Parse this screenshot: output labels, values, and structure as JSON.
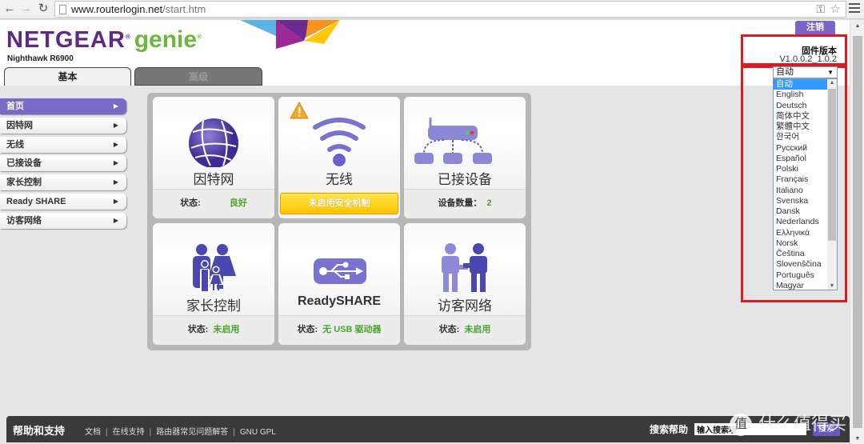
{
  "browser": {
    "url_host": "www.routerlogin.net",
    "url_path": "/start.htm",
    "back_icon": "back-arrow-icon",
    "forward_icon": "forward-arrow-icon",
    "reload_icon": "reload-icon"
  },
  "header": {
    "brand": "NETGEAR",
    "reg_mark": "®",
    "product": "genie",
    "model": "Nighthawk R6900",
    "logout_label": "注销",
    "tabs": [
      {
        "label": "基本",
        "active": true
      },
      {
        "label": "高级",
        "active": false
      }
    ]
  },
  "firmware": {
    "title": "固件版本",
    "version": "V1.0.0.2_1.0.2"
  },
  "language": {
    "selected": "自动",
    "options": [
      "自动",
      "English",
      "Deutsch",
      "简体中文",
      "繁體中文",
      "한국어",
      "Русский",
      "Español",
      "Polski",
      "Français",
      "Italiano",
      "Svenska",
      "Dansk",
      "Nederlands",
      "Ελληνικά",
      "Norsk",
      "Čeština",
      "Slovenščina",
      "Português",
      "Magyar"
    ]
  },
  "sidebar": {
    "items": [
      {
        "label": "首页",
        "active": true
      },
      {
        "label": "因特网",
        "active": false
      },
      {
        "label": "无线",
        "active": false
      },
      {
        "label": "已接设备",
        "active": false
      },
      {
        "label": "家长控制",
        "active": false
      },
      {
        "label": "Ready SHARE",
        "active": false
      },
      {
        "label": "访客网络",
        "active": false
      }
    ]
  },
  "dashboard": {
    "cards": [
      {
        "title": "因特网",
        "icon": "globe-icon",
        "status_label": "状态:",
        "status_value": "良好"
      },
      {
        "title": "无线",
        "icon": "wifi-icon",
        "warning_icon": "warning-icon",
        "warning_text": "未启用安全机制"
      },
      {
        "title": "已接设备",
        "icon": "network-devices-icon",
        "status_label": "设备数量：",
        "status_value": "2"
      },
      {
        "title": "家长控制",
        "icon": "family-icon",
        "status_label": "状态:",
        "status_value": "未启用"
      },
      {
        "title": "ReadySHARE",
        "icon": "usb-icon",
        "status_label": "状态:",
        "status_value": "无 USB 驱动器"
      },
      {
        "title": "访客网络",
        "icon": "guest-handshake-icon",
        "status_label": "状态:",
        "status_value": "未启用"
      }
    ]
  },
  "footer": {
    "title": "帮助和支持",
    "links": [
      "文档",
      "在线支持",
      "路由器常见问题解答",
      "GNU GPL"
    ],
    "search_label": "搜索帮助",
    "search_placeholder": "输入搜索项",
    "search_button": "搜索"
  },
  "watermark": {
    "badge": "值",
    "text": "什么值得买"
  },
  "colors": {
    "brand_purple": "#5f2a86",
    "genie_green": "#6cb83a",
    "accent_purple": "#7a6ac8",
    "status_green": "#4aa32c",
    "warning_yellow": "#ffc300",
    "highlight_red": "#d91c24"
  }
}
